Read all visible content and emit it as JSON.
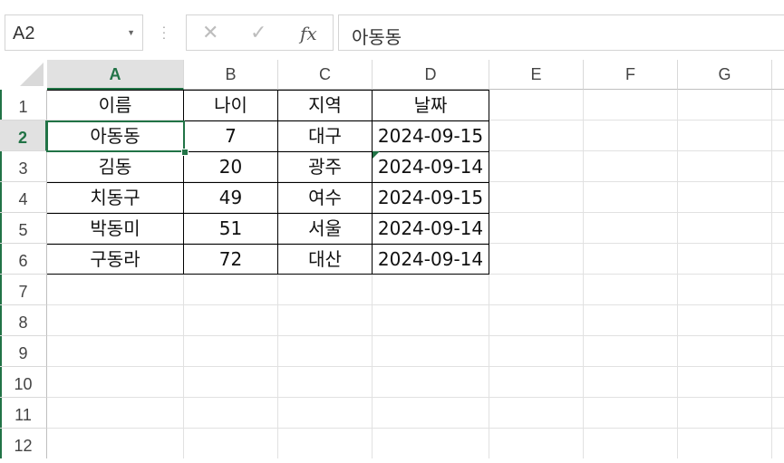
{
  "formula_bar": {
    "name_box": "A2",
    "formula_value": "아동동",
    "fx_label": "fx"
  },
  "columns": [
    "A",
    "B",
    "C",
    "D",
    "E",
    "F",
    "G"
  ],
  "rows": [
    "1",
    "2",
    "3",
    "4",
    "5",
    "6",
    "7",
    "8",
    "9",
    "10",
    "11",
    "12"
  ],
  "selected": {
    "column": "A",
    "row": "2"
  },
  "table": {
    "headers": [
      "이름",
      "나이",
      "지역",
      "날짜"
    ],
    "rows": [
      [
        "아동동",
        "7",
        "대구",
        "2024-09-15"
      ],
      [
        "김동",
        "20",
        "광주",
        "2024-09-14"
      ],
      [
        "치동구",
        "49",
        "여수",
        "2024-09-15"
      ],
      [
        "박동미",
        "51",
        "서울",
        "2024-09-14"
      ],
      [
        "구동라",
        "72",
        "대산",
        "2024-09-14"
      ]
    ]
  },
  "colors": {
    "accent": "#217346",
    "gridline": "#e1e1e1",
    "header_bg": "#e1e1e1"
  }
}
